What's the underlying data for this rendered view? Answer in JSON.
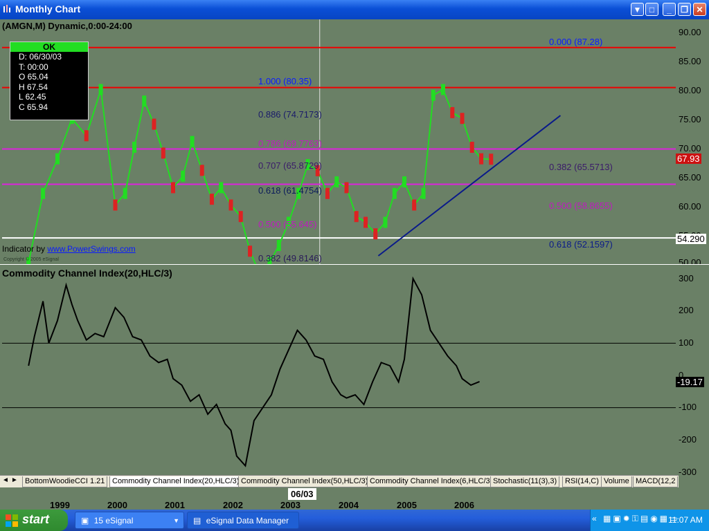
{
  "window": {
    "title": "Monthly Chart"
  },
  "price_pane": {
    "header": "(AMGN,M) Dynamic,0:00-24:00",
    "indicator_prefix": "Indicator by ",
    "indicator_link": "www.PowerSwings.com",
    "copyright": "Copyright © 2005 eSignal",
    "ohlc": {
      "status": "OK",
      "d": "D: 06/30/03",
      "t": "T: 00:00",
      "o": "O 65.04",
      "h": "H 67.54",
      "l": "L 62.45",
      "c": "C 65.94"
    },
    "axis_labels": [
      "90.00",
      "85.00",
      "80.00",
      "75.00",
      "70.00",
      "65.00",
      "60.00",
      "55.00",
      "50.00"
    ],
    "last_price": "67.93",
    "cursor_price": "54.290",
    "fib_left": [
      "1.000 (80.35)",
      "0.886 (74.7173)",
      "0.786 (69.7763)",
      "0.707 (65.8729)",
      "0.618 (61.4754)",
      "0.500 (55.645)",
      "0.382 (49.8146)"
    ],
    "fib_right": [
      "0.000 (87.28)",
      "0.382 (65.5713)",
      "0.500 (58.8655)",
      "0.618 (52.1597)"
    ],
    "colors": {
      "up": "#22dd22",
      "down": "#dd2222",
      "fib_blue": "#0a1aff",
      "fib_purple": "#7a1a8a",
      "fib_magenta": "#d41ad4",
      "bg": "#6a8066"
    }
  },
  "cci_pane": {
    "header": "Commodity Channel Index(20,HLC/3)",
    "axis_labels": [
      "300",
      "200",
      "100",
      "0",
      "-100",
      "-200",
      "-300"
    ],
    "last_value": "-19.17"
  },
  "tabs": [
    "BottomWoodieCCI 1.21",
    "Commodity Channel Index(20,HLC/3)",
    "Commodity Channel Index(50,HLC/3)",
    "Commodity Channel Index(6,HLC/3)",
    "Stochastic(11(3),3)",
    "RSI(14,C)",
    "Volume",
    "MACD(12,2"
  ],
  "active_tab": 1,
  "time_axis": {
    "years": [
      "1999",
      "2000",
      "2001",
      "2002",
      "2003",
      "2004",
      "2005",
      "2006"
    ],
    "cursor_date": "06/03"
  },
  "chart_data": {
    "type": "line",
    "symbol": "AMGN",
    "interval": "Monthly",
    "price_range": [
      49.5,
      92
    ],
    "cci_range": [
      -300,
      300
    ],
    "horizontal_lines": [
      {
        "price": 87.28,
        "color": "#ee0000"
      },
      {
        "price": 80.35,
        "color": "#ee0000"
      },
      {
        "price": 69.7,
        "color": "#dd22dd"
      },
      {
        "price": 63.6,
        "color": "#dd22dd"
      },
      {
        "price": 54.29,
        "color": "#ffffff"
      }
    ],
    "price_series_xy": [
      [
        1998.5,
        50
      ],
      [
        1998.75,
        62
      ],
      [
        1999,
        68
      ],
      [
        1999.25,
        75
      ],
      [
        1999.5,
        72
      ],
      [
        1999.75,
        80
      ],
      [
        2000,
        60
      ],
      [
        2000.17,
        62
      ],
      [
        2000.33,
        70
      ],
      [
        2000.5,
        78
      ],
      [
        2000.67,
        74
      ],
      [
        2000.83,
        69
      ],
      [
        2001,
        63
      ],
      [
        2001.17,
        65
      ],
      [
        2001.33,
        71
      ],
      [
        2001.5,
        66
      ],
      [
        2001.67,
        61
      ],
      [
        2001.83,
        63
      ],
      [
        2002,
        60
      ],
      [
        2002.17,
        58
      ],
      [
        2002.33,
        52
      ],
      [
        2002.5,
        48
      ],
      [
        2002.67,
        50
      ],
      [
        2002.83,
        53
      ],
      [
        2003,
        57
      ],
      [
        2003.17,
        62
      ],
      [
        2003.33,
        67
      ],
      [
        2003.5,
        65.94
      ],
      [
        2003.67,
        62
      ],
      [
        2003.83,
        64
      ],
      [
        2004,
        63
      ],
      [
        2004.17,
        58
      ],
      [
        2004.33,
        57
      ],
      [
        2004.5,
        55
      ],
      [
        2004.67,
        57
      ],
      [
        2004.83,
        62
      ],
      [
        2005,
        64
      ],
      [
        2005.17,
        60
      ],
      [
        2005.33,
        62
      ],
      [
        2005.5,
        79
      ],
      [
        2005.67,
        80
      ],
      [
        2005.83,
        76
      ],
      [
        2006,
        75
      ],
      [
        2006.17,
        70
      ],
      [
        2006.33,
        68
      ],
      [
        2006.5,
        67.93
      ]
    ],
    "cci_series_xy": [
      [
        1998.5,
        30
      ],
      [
        1998.6,
        120
      ],
      [
        1998.75,
        230
      ],
      [
        1998.85,
        100
      ],
      [
        1999,
        170
      ],
      [
        1999.15,
        280
      ],
      [
        1999.25,
        220
      ],
      [
        1999.35,
        170
      ],
      [
        1999.5,
        110
      ],
      [
        1999.65,
        130
      ],
      [
        1999.8,
        120
      ],
      [
        2000,
        210
      ],
      [
        2000.15,
        180
      ],
      [
        2000.3,
        120
      ],
      [
        2000.45,
        110
      ],
      [
        2000.6,
        60
      ],
      [
        2000.75,
        40
      ],
      [
        2000.9,
        50
      ],
      [
        2001,
        -10
      ],
      [
        2001.15,
        -30
      ],
      [
        2001.3,
        -80
      ],
      [
        2001.45,
        -60
      ],
      [
        2001.6,
        -120
      ],
      [
        2001.75,
        -90
      ],
      [
        2001.9,
        -150
      ],
      [
        2002,
        -170
      ],
      [
        2002.1,
        -250
      ],
      [
        2002.25,
        -280
      ],
      [
        2002.4,
        -140
      ],
      [
        2002.55,
        -100
      ],
      [
        2002.7,
        -60
      ],
      [
        2002.85,
        20
      ],
      [
        2003,
        80
      ],
      [
        2003.15,
        140
      ],
      [
        2003.3,
        110
      ],
      [
        2003.45,
        60
      ],
      [
        2003.6,
        50
      ],
      [
        2003.75,
        -20
      ],
      [
        2003.9,
        -60
      ],
      [
        2004,
        -70
      ],
      [
        2004.15,
        -60
      ],
      [
        2004.3,
        -90
      ],
      [
        2004.45,
        -20
      ],
      [
        2004.6,
        40
      ],
      [
        2004.75,
        30
      ],
      [
        2004.9,
        -20
      ],
      [
        2005,
        50
      ],
      [
        2005.15,
        300
      ],
      [
        2005.3,
        250
      ],
      [
        2005.45,
        140
      ],
      [
        2005.6,
        100
      ],
      [
        2005.75,
        60
      ],
      [
        2005.9,
        30
      ],
      [
        2006,
        -10
      ],
      [
        2006.15,
        -30
      ],
      [
        2006.3,
        -19.17
      ]
    ]
  }
}
